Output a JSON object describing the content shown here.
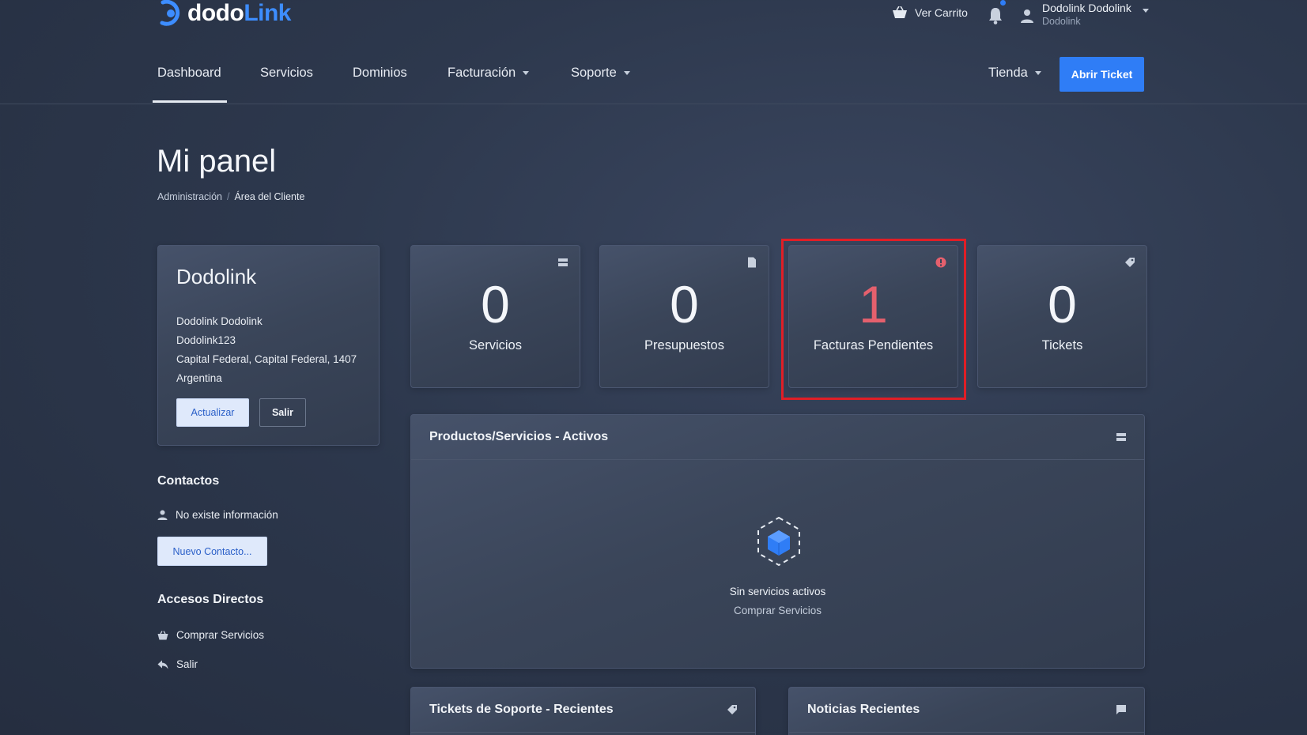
{
  "brand": {
    "part1": "dodo",
    "part2": "Link",
    "accent": "#3d8dff"
  },
  "header": {
    "cart_label": "Ver Carrito",
    "user_name": "Dodolink Dodolink",
    "user_company": "Dodolink"
  },
  "nav": {
    "items": [
      {
        "label": "Dashboard",
        "active": true
      },
      {
        "label": "Servicios"
      },
      {
        "label": "Dominios"
      },
      {
        "label": "Facturación",
        "dropdown": true
      },
      {
        "label": "Soporte",
        "dropdown": true
      }
    ],
    "store_label": "Tienda",
    "ticket_button": "Abrir Ticket"
  },
  "page": {
    "title": "Mi panel",
    "breadcrumb": [
      "Administración",
      "Área del Cliente"
    ]
  },
  "profile": {
    "title": "Dodolink",
    "lines": [
      "Dodolink Dodolink",
      "Dodolink123",
      "Capital Federal, Capital Federal, 1407",
      "Argentina"
    ],
    "update_button": "Actualizar",
    "logout_button": "Salir"
  },
  "contacts": {
    "title": "Contactos",
    "empty": "No existe información",
    "new_button": "Nuevo Contacto..."
  },
  "shortcuts": {
    "title": "Accesos Directos",
    "items": [
      "Comprar Servicios",
      "Salir"
    ]
  },
  "stats": [
    {
      "value": "0",
      "label": "Servicios",
      "icon": "server-icon"
    },
    {
      "value": "0",
      "label": "Presupuestos",
      "icon": "document-icon"
    },
    {
      "value": "1",
      "label": "Facturas Pendientes",
      "icon": "alert-icon",
      "alert_color": "#e5606d"
    },
    {
      "value": "0",
      "label": "Tickets",
      "icon": "tag-icon"
    }
  ],
  "products_panel": {
    "title": "Productos/Servicios - Activos",
    "empty_text": "Sin servicios activos",
    "empty_link": "Comprar Servicios"
  },
  "tickets_panel": {
    "title": "Tickets de Soporte - Recientes"
  },
  "news_panel": {
    "title": "Noticias Recientes"
  },
  "highlight_color": "#e01e26"
}
